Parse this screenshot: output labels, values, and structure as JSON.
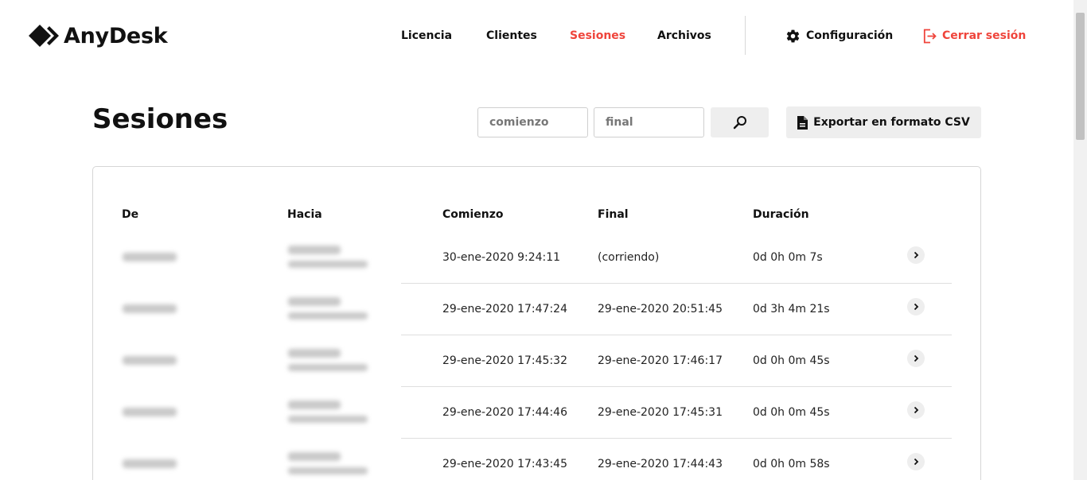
{
  "brand": {
    "name": "AnyDesk"
  },
  "nav": {
    "items": [
      {
        "label": "Licencia",
        "active": false
      },
      {
        "label": "Clientes",
        "active": false
      },
      {
        "label": "Sesiones",
        "active": true
      },
      {
        "label": "Archivos",
        "active": false
      }
    ],
    "settings_label": "Configuración",
    "logout_label": "Cerrar sesión"
  },
  "page": {
    "title": "Sesiones"
  },
  "filters": {
    "start_placeholder": "comienzo",
    "end_placeholder": "final",
    "search_icon": "search-icon",
    "export_label": "Exportar en formato CSV",
    "export_icon": "file-icon"
  },
  "table": {
    "headers": [
      "De",
      "Hacia",
      "Comienzo",
      "Final",
      "Duración"
    ],
    "rows": [
      {
        "start": "30-ene-2020 9:24:11",
        "end": "(corriendo)",
        "duration": "0d 0h 0m 7s"
      },
      {
        "start": "29-ene-2020 17:47:24",
        "end": "29-ene-2020 20:51:45",
        "duration": "0d 3h 4m 21s"
      },
      {
        "start": "29-ene-2020 17:45:32",
        "end": "29-ene-2020 17:46:17",
        "duration": "0d 0h 0m 45s"
      },
      {
        "start": "29-ene-2020 17:44:46",
        "end": "29-ene-2020 17:45:31",
        "duration": "0d 0h 0m 45s"
      },
      {
        "start": "29-ene-2020 17:43:45",
        "end": "29-ene-2020 17:44:43",
        "duration": "0d 0h 0m 58s"
      }
    ]
  },
  "colors": {
    "accent": "#ef443b",
    "text": "#111111",
    "button_bg": "#eeeeee",
    "border": "#d6d6d6"
  }
}
